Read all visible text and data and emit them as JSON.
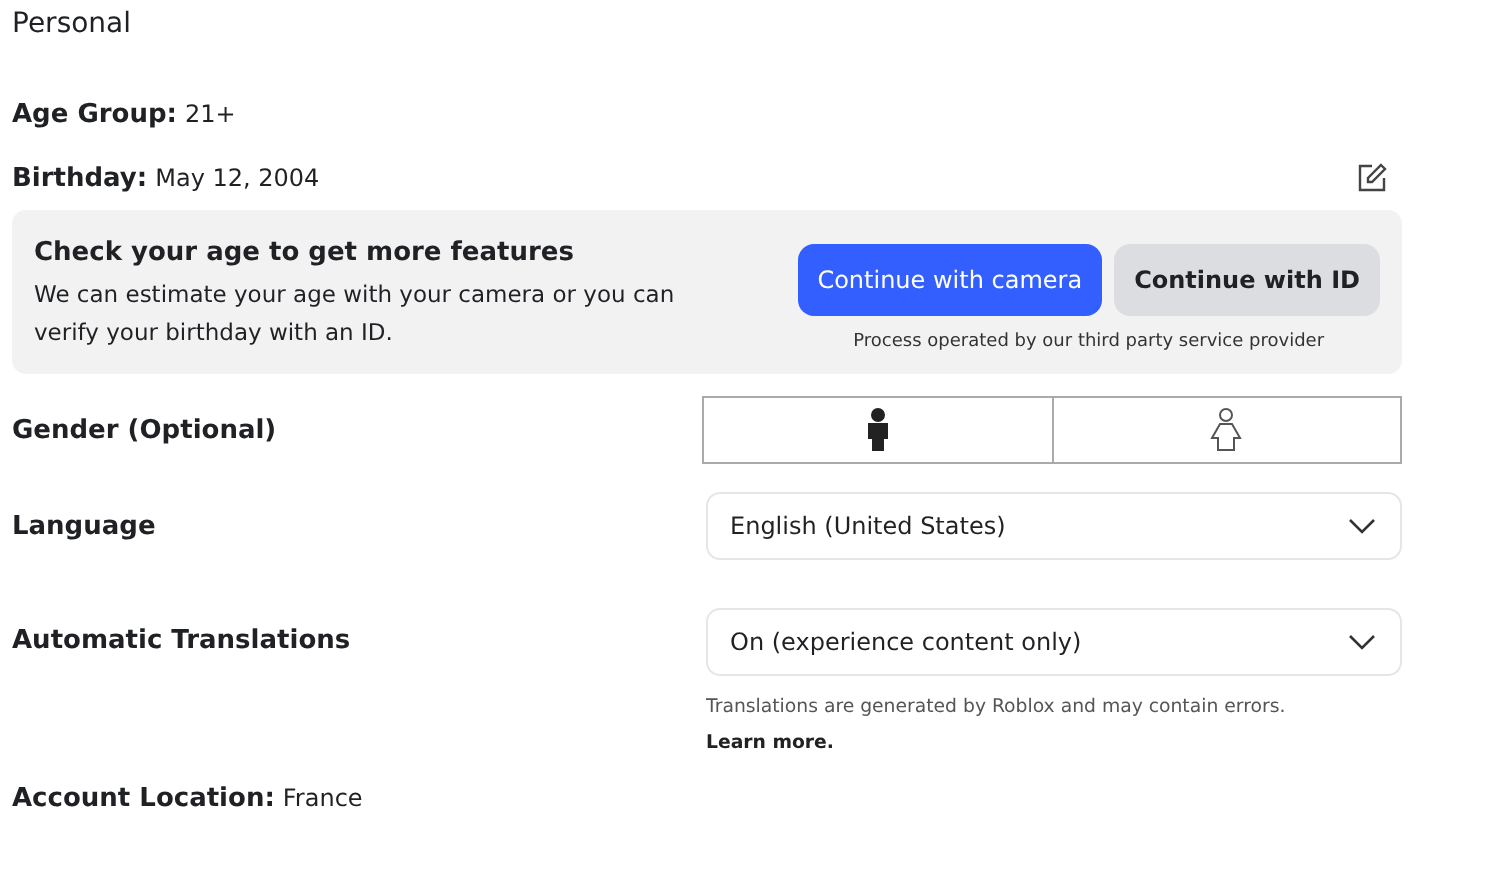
{
  "section_title": "Personal",
  "age_group": {
    "label": "Age Group:",
    "value": "21+"
  },
  "birthday": {
    "label": "Birthday:",
    "value": "May 12, 2004"
  },
  "age_check": {
    "title": "Check your age to get more features",
    "description": "We can estimate your age with your camera or you can verify your birthday with an ID.",
    "buttons": [
      {
        "label": "Continue with camera",
        "kind": "primary"
      },
      {
        "label": "Continue with ID",
        "kind": "secondary"
      }
    ],
    "note": "Process operated by our third party service provider"
  },
  "gender": {
    "label": "Gender (Optional)",
    "options": [
      {
        "kind": "male",
        "selected": true
      },
      {
        "kind": "female",
        "selected": false
      }
    ]
  },
  "language": {
    "label": "Language",
    "value": "English (United States)"
  },
  "translations": {
    "label": "Automatic Translations",
    "value": "On (experience content only)",
    "note": "Translations are generated by Roblox and may contain errors.",
    "link": "Learn more."
  },
  "account_location": {
    "label": "Account Location:",
    "value": "France"
  }
}
